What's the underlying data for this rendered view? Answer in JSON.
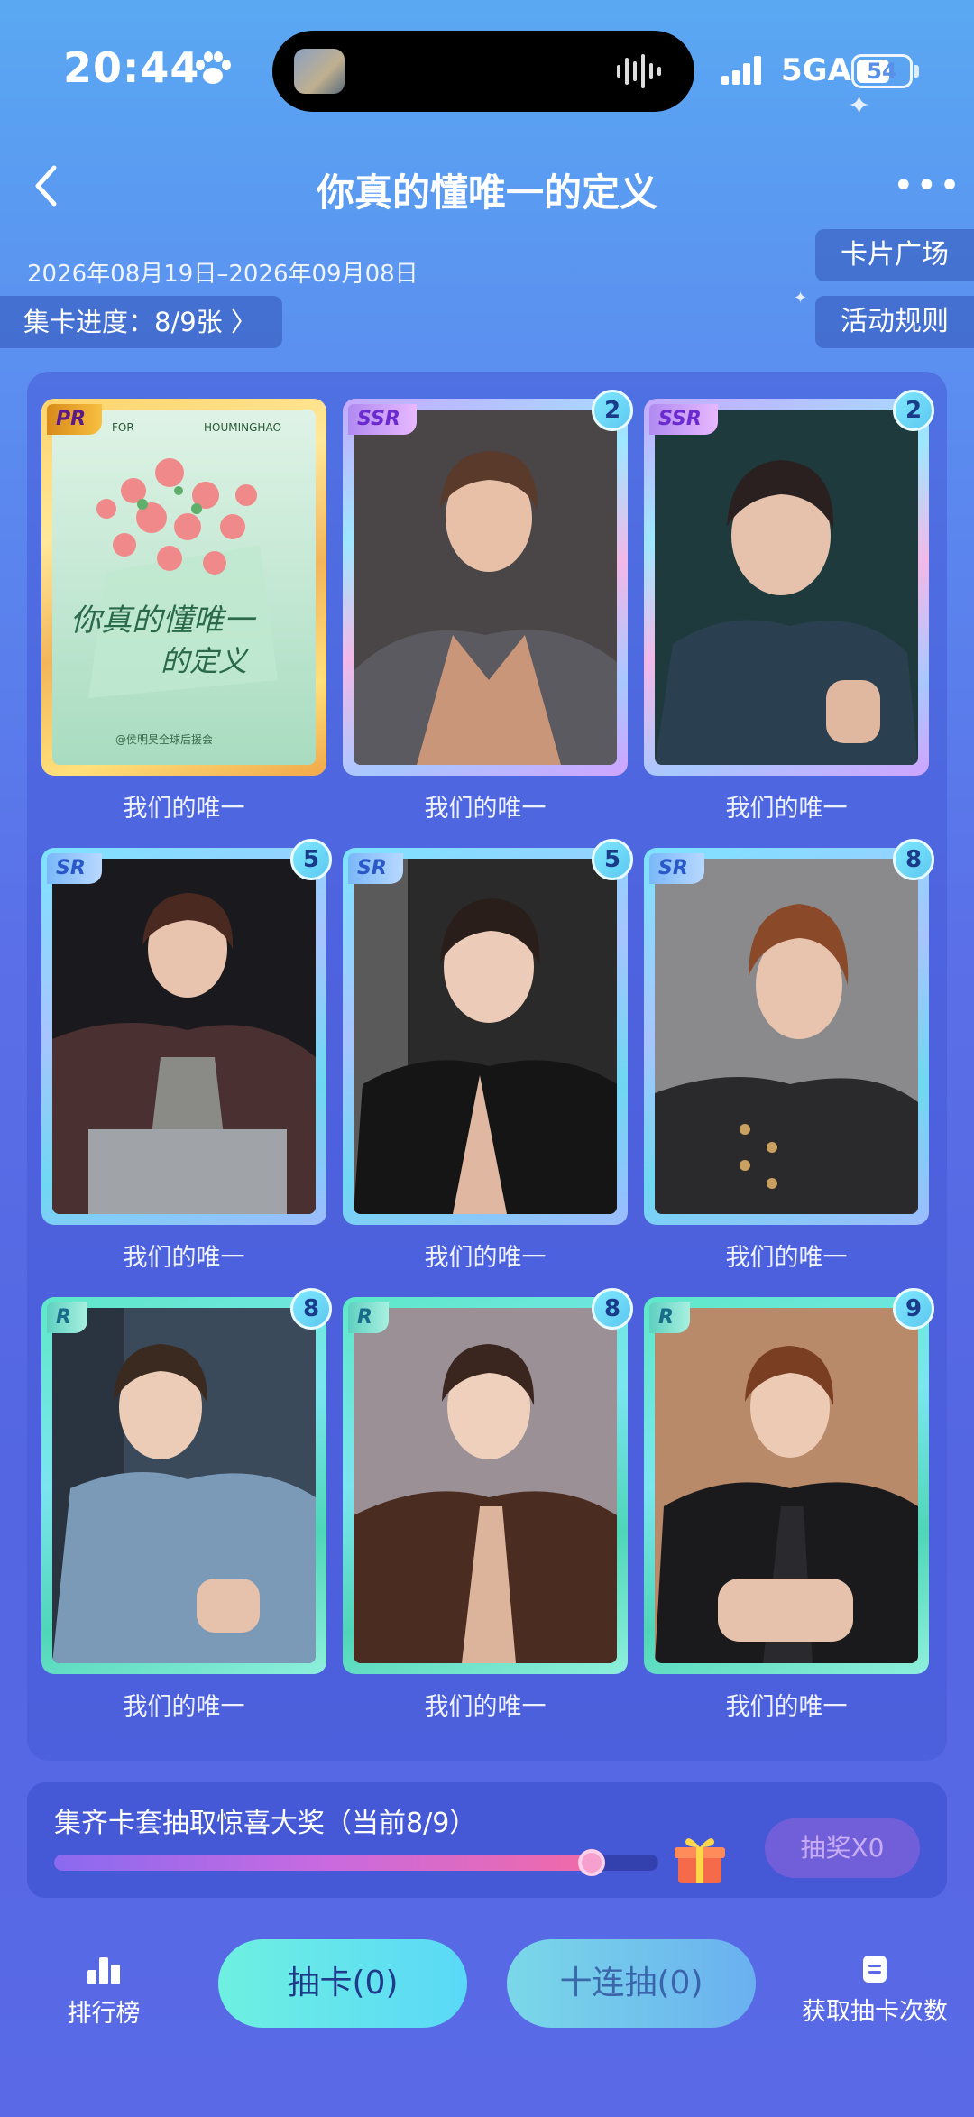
{
  "status_bar": {
    "time": "20:44",
    "network": "5GA",
    "battery": "54"
  },
  "header": {
    "title": "你真的懂唯一的定义"
  },
  "event": {
    "date_range": "2026年08月19日–2026年09月08日",
    "progress_label": "集卡进度：8/9张 〉",
    "card_square_label": "卡片广场",
    "rules_label": "活动规则"
  },
  "cards": [
    {
      "rarity": "PR",
      "count": "",
      "label": "我们的唯一",
      "header_left": "FOR",
      "header_right": "HOUMINGHAO",
      "footer": "@侯明昊全球后援会"
    },
    {
      "rarity": "SSR",
      "count": "2",
      "label": "我们的唯一"
    },
    {
      "rarity": "SSR",
      "count": "2",
      "label": "我们的唯一"
    },
    {
      "rarity": "SR",
      "count": "5",
      "label": "我们的唯一"
    },
    {
      "rarity": "SR",
      "count": "5",
      "label": "我们的唯一"
    },
    {
      "rarity": "SR",
      "count": "8",
      "label": "我们的唯一"
    },
    {
      "rarity": "R",
      "count": "8",
      "label": "我们的唯一"
    },
    {
      "rarity": "R",
      "count": "8",
      "label": "我们的唯一"
    },
    {
      "rarity": "R",
      "count": "9",
      "label": "我们的唯一"
    }
  ],
  "reward": {
    "text": "集齐卡套抽取惊喜大奖（当前8/9）",
    "progress": 0.89,
    "button_label": "抽奖X0"
  },
  "bottom_nav": {
    "ranking_label": "排行榜",
    "draw_label": "抽卡(0)",
    "ten_draw_label": "十连抽(0)",
    "get_chances_label": "获取抽卡次数"
  },
  "colors": {
    "accent": "#5ad8f8",
    "background_top": "#5aa8f2",
    "background_bottom": "#5466e2"
  }
}
